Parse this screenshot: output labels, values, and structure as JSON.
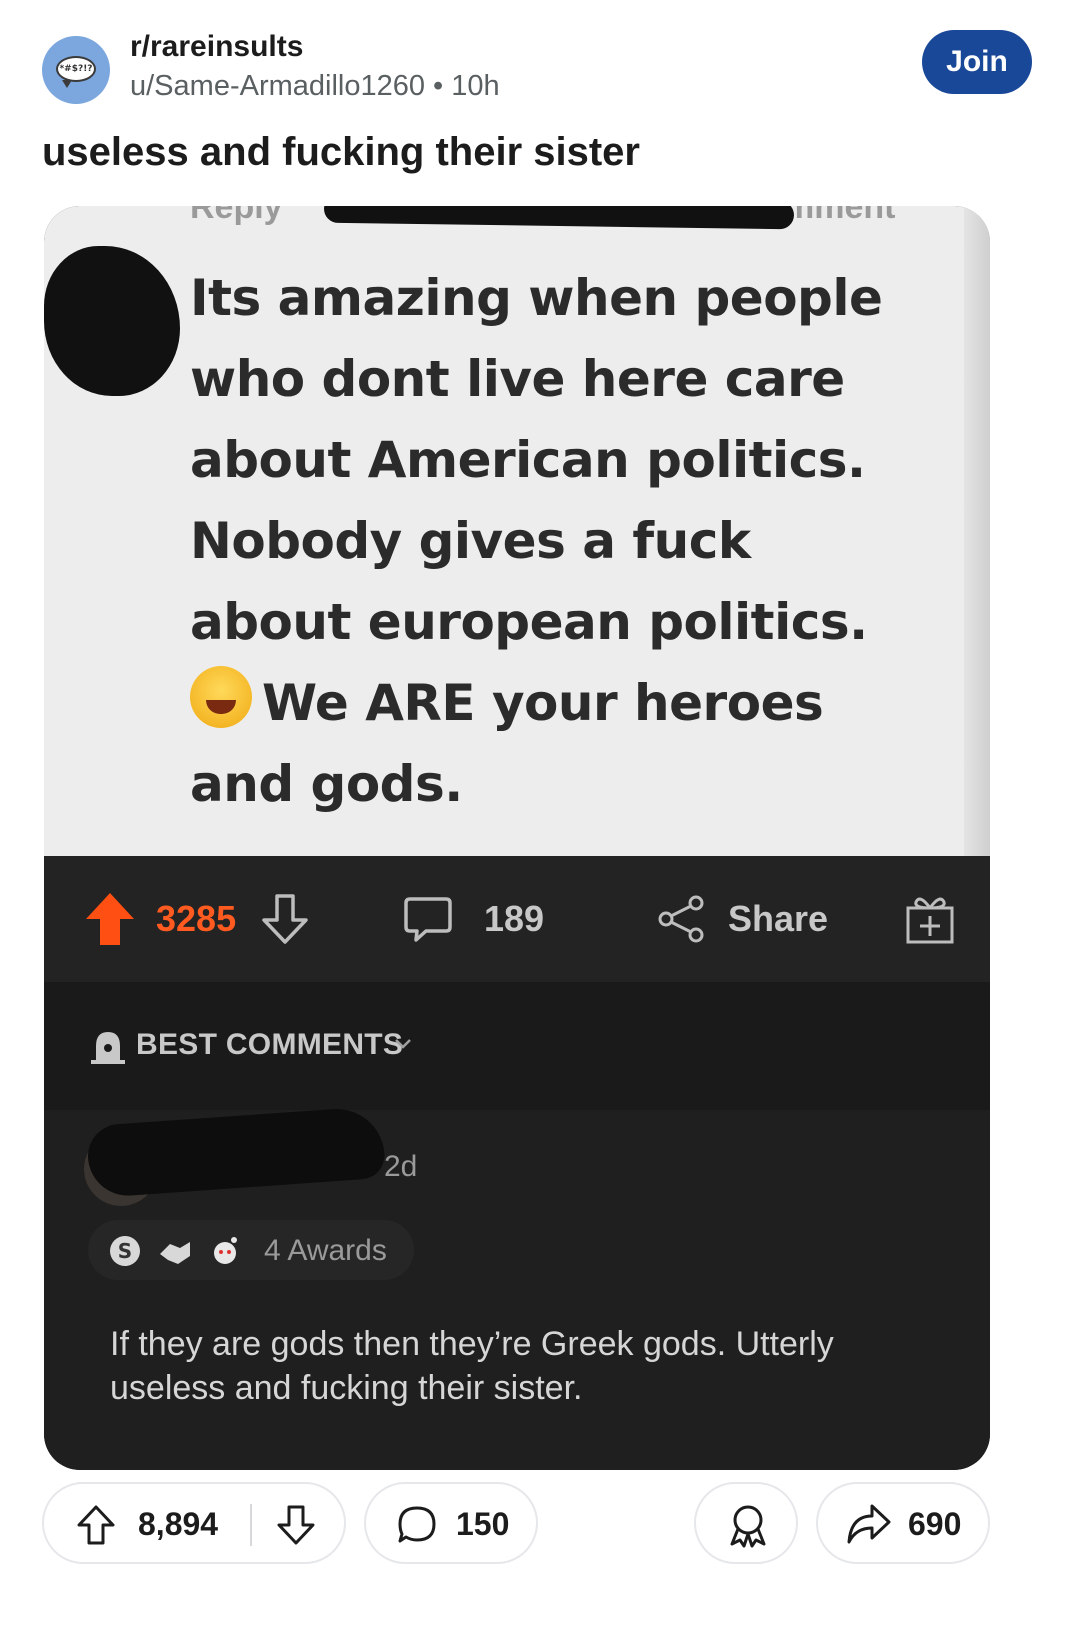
{
  "header": {
    "subreddit": "r/rareinsults",
    "author": "u/Same-Armadillo1260",
    "separator": "•",
    "age": "10h",
    "join_label": "Join",
    "avatar_text": "*#$?!?"
  },
  "post": {
    "title": "useless and fucking their sister"
  },
  "image": {
    "reply_fragment": "Reply",
    "comment_fragment": "mment",
    "quoted_lines": {
      "l1": "Its amazing when people",
      "l2": "who dont live here care",
      "l3": "about American politics.",
      "l4": "Nobody gives a fuck",
      "l5": "about european politics.",
      "l6": "We ARE your heroes",
      "l7": "and gods."
    },
    "actions": {
      "vote_count": "3285",
      "comment_count": "189",
      "share_label": "Share"
    },
    "sort_label": "BEST COMMENTS",
    "comment": {
      "time": "2d",
      "awards_label": "4 Awards",
      "body": "If they are gods then they’re Greek gods. Utterly useless and fucking their sister."
    },
    "colors": {
      "upvote": "#ff5a1f",
      "dark_bg": "#1f1f1f"
    }
  },
  "footer": {
    "score": "8,894",
    "comments": "150",
    "shares": "690"
  },
  "colors": {
    "join_bg": "#1a4899",
    "avatar_bg": "#7ba7de"
  },
  "icons": [
    "speech-bubble-avatar-icon",
    "upvote-icon",
    "downvote-icon",
    "comment-icon",
    "share-icon",
    "gift-icon",
    "alert-bell-icon",
    "chevron-down-icon",
    "award-icon",
    "share-arrow-icon"
  ]
}
